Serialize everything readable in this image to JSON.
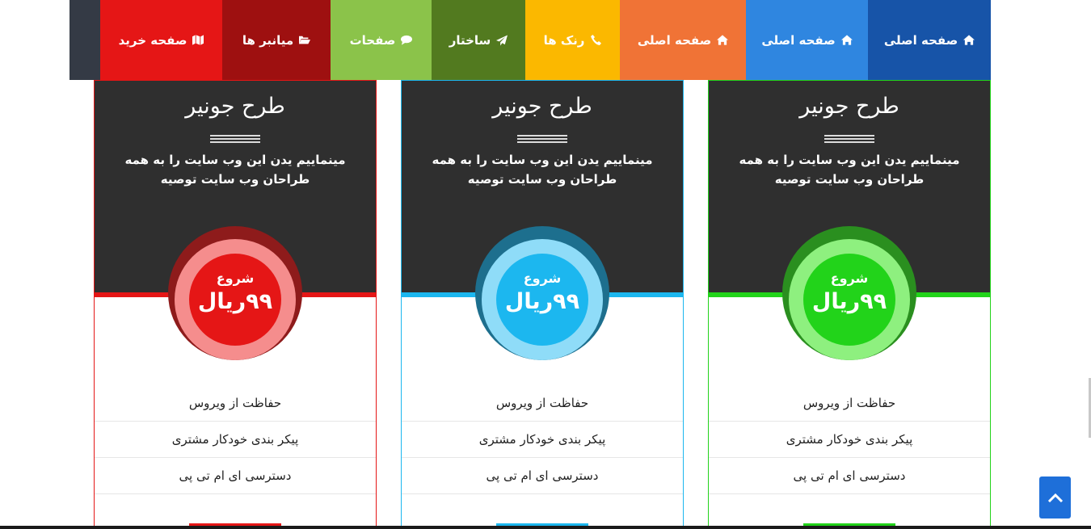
{
  "colors": {
    "nav_dark": "#343a45",
    "nav": [
      "#1754a8",
      "#2f86e0",
      "#f07336",
      "#fbb800",
      "#527a1f",
      "#8bc34a",
      "#9e1010",
      "#e51616"
    ],
    "card_green": "#22d31a",
    "card_blue": "#1cb7ef",
    "card_red": "#e51616",
    "card_top": "#2f2f2f",
    "to_top": "#1e6fd9"
  },
  "nav": {
    "items": [
      {
        "label": "صفحه اصلی",
        "icon": "home-icon"
      },
      {
        "label": "صفحه اصلی",
        "icon": "home-icon"
      },
      {
        "label": "صفحه اصلی",
        "icon": "home-icon"
      },
      {
        "label": "رنک ها",
        "icon": "phone-icon"
      },
      {
        "label": "ساختار",
        "icon": "paper-plane-icon"
      },
      {
        "label": "صفحات",
        "icon": "comment-icon"
      },
      {
        "label": "میانبر ها",
        "icon": "folder-open-icon"
      },
      {
        "label": "صفحه خرید",
        "icon": "map-icon"
      }
    ]
  },
  "cards": [
    {
      "title": "طرح جونیر",
      "desc": "مینماییم یدن این وب سایت را به همه طراحان وب سایت توصیه",
      "price_label": "شروع",
      "price_value": "۹۹ریال",
      "features": [
        "حفاظت از ویروس",
        "پیکر بندی خودکار مشتری",
        "دسترسی ای ام تی پی"
      ]
    },
    {
      "title": "طرح جونیر",
      "desc": "مینماییم یدن این وب سایت را به همه طراحان وب سایت توصیه",
      "price_label": "شروع",
      "price_value": "۹۹ریال",
      "features": [
        "حفاظت از ویروس",
        "پیکر بندی خودکار مشتری",
        "دسترسی ای ام تی پی"
      ]
    },
    {
      "title": "طرح جونیر",
      "desc": "مینماییم یدن این وب سایت را به همه طراحان وب سایت توصیه",
      "price_label": "شروع",
      "price_value": "۹۹ریال",
      "features": [
        "حفاظت از ویروس",
        "پیکر بندی خودکار مشتری",
        "دسترسی ای ام تی پی"
      ]
    }
  ],
  "to_top": {
    "icon": "chevron-up-icon"
  }
}
